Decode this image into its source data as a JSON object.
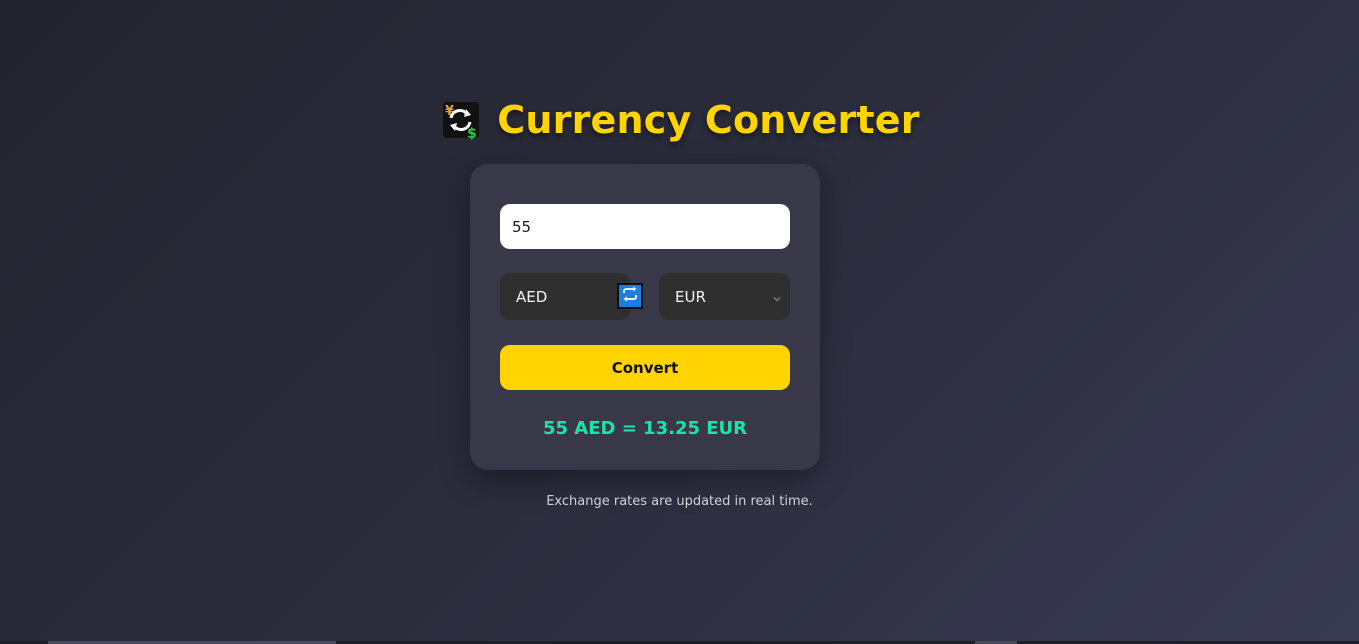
{
  "header": {
    "title": "Currency Converter",
    "logo_icon": "currency-exchange-icon"
  },
  "converter": {
    "amount": "55",
    "from_currency": "AED",
    "to_currency": "EUR",
    "swap_icon": "swap-arrows-icon",
    "convert_label": "Convert",
    "result": "55 AED = 13.25 EUR"
  },
  "footer": {
    "note": "Exchange rates are updated in real time."
  },
  "colors": {
    "accent": "#ffd400",
    "result": "#17e6a4",
    "swap_button": "#1a7fe0",
    "card": "#383849"
  }
}
